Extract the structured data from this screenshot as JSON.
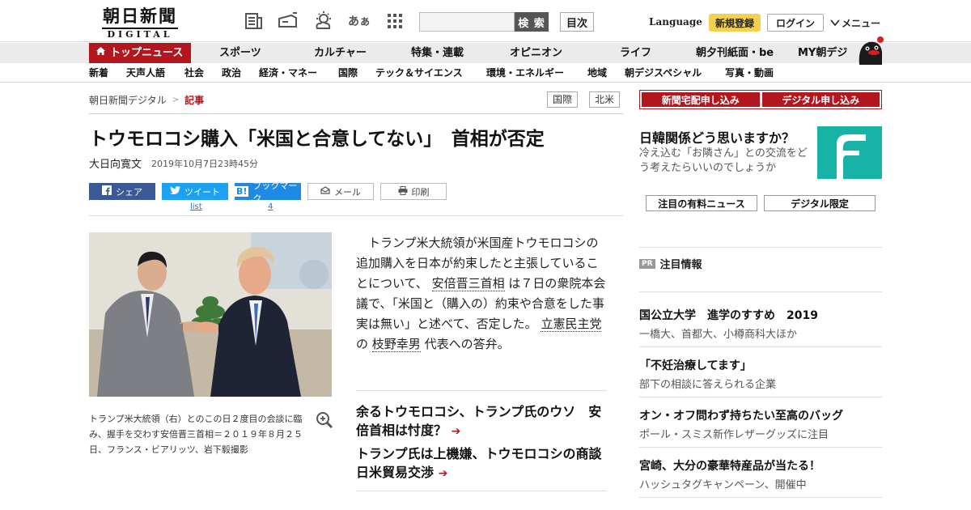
{
  "header": {
    "logo_main": "朝日新聞",
    "logo_sub": "DIGITAL",
    "search_button": "検 索",
    "toc_button": "目次",
    "language": "Language",
    "register": "新規登録",
    "login": "ログイン",
    "menu": "メニュー",
    "icons": [
      "paper-icon",
      "radio-icon",
      "weather-icon",
      "font-size-icon",
      "grid-icon"
    ],
    "font_icon_text": "あぁ"
  },
  "nav_primary": [
    "トップニュース",
    "スポーツ",
    "カルチャー",
    "特集・連載",
    "オピニオン",
    "ライフ",
    "朝夕刊紙面・be",
    "MY朝デジ"
  ],
  "nav_secondary": [
    "新着",
    "天声人語",
    "社会",
    "政治",
    "経済・マネー",
    "国際",
    "テック＆サイエンス",
    "環境・エネルギー",
    "地域",
    "朝デジスペシャル",
    "写真・動画"
  ],
  "breadcrumb": {
    "home": "朝日新聞デジタル",
    "sep": ">",
    "current": "記事"
  },
  "tags": [
    "国際",
    "北米"
  ],
  "article": {
    "title": "トウモロコシ購入「米国と合意してない」　首相が否定",
    "author": "大日向寛文",
    "date": "2019年10月7日23時45分",
    "share": {
      "facebook": "シェア",
      "twitter": "ツイート",
      "hatena": "ブックマーク",
      "mail": "メール",
      "print": "印刷",
      "twitter_count": "list",
      "hatena_count": "4"
    },
    "caption": "トランプ米大統領（右）とのこの日２度目の会談に臨み、握手を交わす安倍晋三首相＝２０１９年８月２５日、フランス・ビアリッツ、岩下毅撮影",
    "body": {
      "p1": "トランプ米大統領が米国産トウモロコシの追加購入を日本が約束したと主張していることについて、",
      "link1": "安倍晋三首相",
      "p2": "は７日の衆院本会議で、「米国と（購入の）約束や合意をした事実は無い」と述べて、否定した。",
      "link2": "立憲民主党",
      "p3": "の",
      "link3": "枝野幸男",
      "p4": "代表への答弁。"
    },
    "related": [
      "余るトウモロコシ、トランプ氏のウソ　安倍首相は忖度？",
      "トランプ氏は上機嫌、トウモロコシの商談　日米貿易交渉"
    ]
  },
  "sidebar": {
    "btn_newspaper": "新聞宅配申し込み",
    "btn_digital": "デジタル申し込み",
    "survey_title": "日韓関係どう思いますか？",
    "survey_sub": "冷え込む「お隣さん」との交流をどう考えたらいいのでしょうか",
    "btn_paid_news": "注目の有料ニュース",
    "btn_digital_only": "デジタル限定",
    "pr_badge": "PR",
    "pr_heading": "注目情報",
    "pr_items": [
      {
        "title": "国公立大学　進学のすすめ　2019",
        "sub": "一橋大、首都大、小樽商科大ほか"
      },
      {
        "title": "「不妊治療してます」",
        "sub": "部下の相談に答えられる企業"
      },
      {
        "title": "オン・オフ問わず持ちたい至高のバッグ",
        "sub": "ポール・スミス新作レザーグッズに注目"
      },
      {
        "title": "宮崎、大分の豪華特産品が当たる！",
        "sub": "ハッシュタグキャンペーン、開催中"
      }
    ]
  },
  "colors": {
    "brand_red": "#b3171d",
    "accent_yellow": "#f5d04f",
    "survey_teal": "#17b3a6"
  }
}
